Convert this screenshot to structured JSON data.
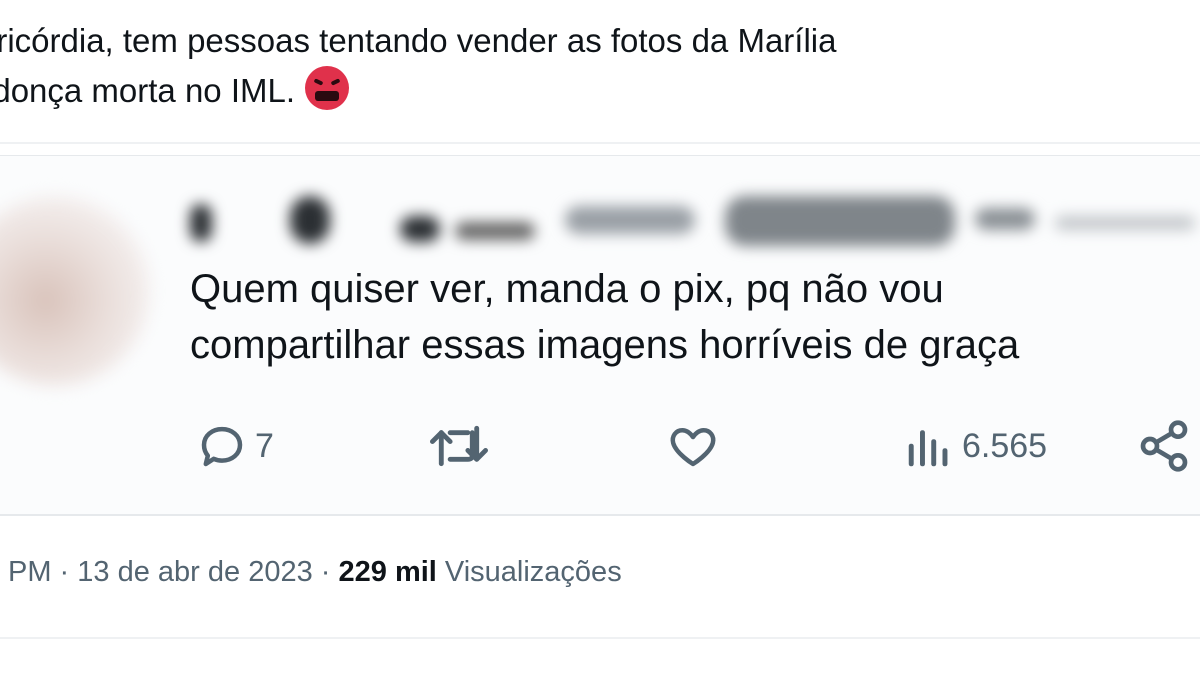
{
  "tweet": {
    "line1": "ericórdia, tem pessoas tentando vender as fotos da Marília",
    "line2": "ndonça morta no IML.",
    "emoji": "angry-face-with-symbols-emoji"
  },
  "quote": {
    "line1": "Quem quiser ver, manda o pix, pq não vou",
    "line2": "compartilhar  essas imagens horríveis de graça",
    "actions": {
      "reply_count": "7",
      "views_count": "6.565"
    }
  },
  "meta": {
    "time": "PM",
    "separator1": " · ",
    "date": "13 de abr de 2023",
    "separator2": " · ",
    "views_number": "229 mil",
    "views_label": " Visualizações"
  },
  "icons": [
    "reply-icon",
    "retweet-icon",
    "like-icon",
    "views-chart-icon",
    "share-icon"
  ],
  "colors": {
    "text": "#0f1419",
    "secondary": "#536471",
    "emoji": "#e0314b"
  }
}
